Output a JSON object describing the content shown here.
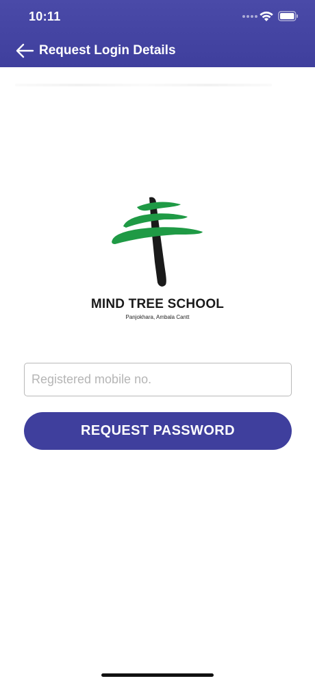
{
  "status_bar": {
    "time": "10:11",
    "icons": [
      "cellular-dots-icon",
      "wifi-icon",
      "battery-icon"
    ]
  },
  "nav": {
    "back_icon": "arrow-left-icon",
    "title": "Request Login Details"
  },
  "logo": {
    "icon": "tree-logo-icon",
    "school_name": "MIND TREE SCHOOL",
    "location": "Panjokhara, Ambala Cantt"
  },
  "form": {
    "mobile_value": "",
    "mobile_placeholder": "Registered mobile no.",
    "submit_label": "REQUEST PASSWORD"
  },
  "colors": {
    "primary": "#3f3f9d",
    "logo_green": "#1f9a45",
    "logo_trunk": "#1a1a1a"
  }
}
